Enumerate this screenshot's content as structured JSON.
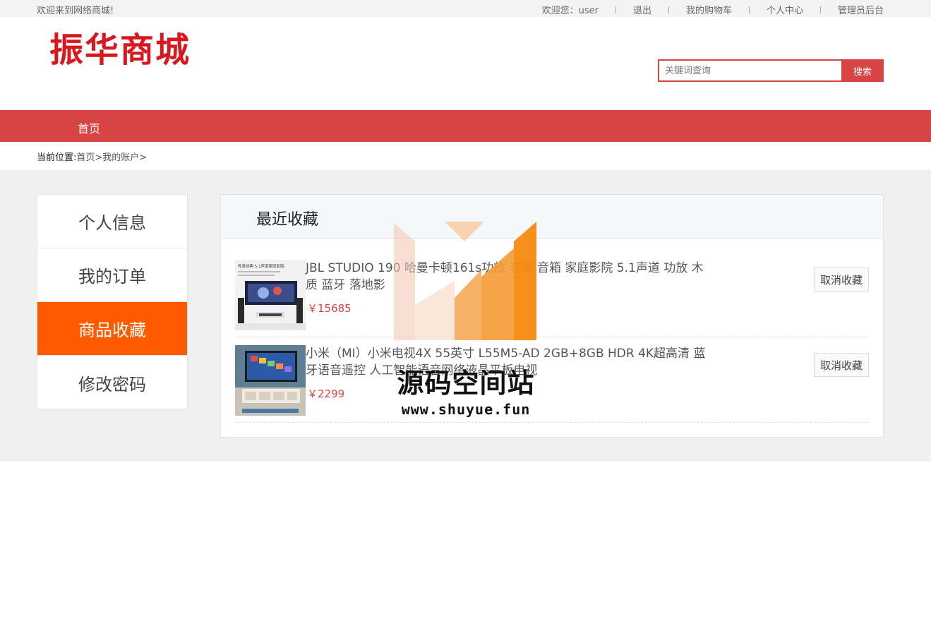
{
  "topbar": {
    "welcome": "欢迎来到网络商城!",
    "user_greeting": "欢迎您：user",
    "logout": "退出",
    "cart": "我的购物车",
    "profile": "个人中心",
    "admin": "管理员后台"
  },
  "header": {
    "logo": "振华商城",
    "search_placeholder": "关键词查询",
    "search_button": "搜索"
  },
  "nav": {
    "home": "首页"
  },
  "breadcrumb": {
    "label": "当前位置:",
    "path": "首页>我的账户>"
  },
  "sidebar": {
    "items": [
      {
        "label": "个人信息",
        "active": false
      },
      {
        "label": "我的订单",
        "active": false
      },
      {
        "label": "商品收藏",
        "active": true
      },
      {
        "label": "修改密码",
        "active": false
      }
    ]
  },
  "favorites": {
    "title": "最近收藏",
    "cancel_label": "取消收藏",
    "items": [
      {
        "name": "JBL STUDIO 190 哈曼卡顿161s功放 音响 音箱 家庭影院 5.1声道 功放 木质 蓝牙 落地影",
        "price": "￥15685",
        "thumb_caption": "传承经典 5.1声道家庭影院"
      },
      {
        "name": "小米（MI）小米电视4X 55英寸 L55M5-AD 2GB+8GB HDR 4K超高清 蓝牙语音遥控 人工智能语音网络液晶平板电视",
        "price": "￥2299"
      }
    ]
  },
  "watermark": {
    "text": "源码空间站",
    "url": "www.shuyue.fun"
  },
  "colors": {
    "brand_red": "#d84444",
    "active_orange": "#ff5a00",
    "logo_red": "#d8171e"
  }
}
